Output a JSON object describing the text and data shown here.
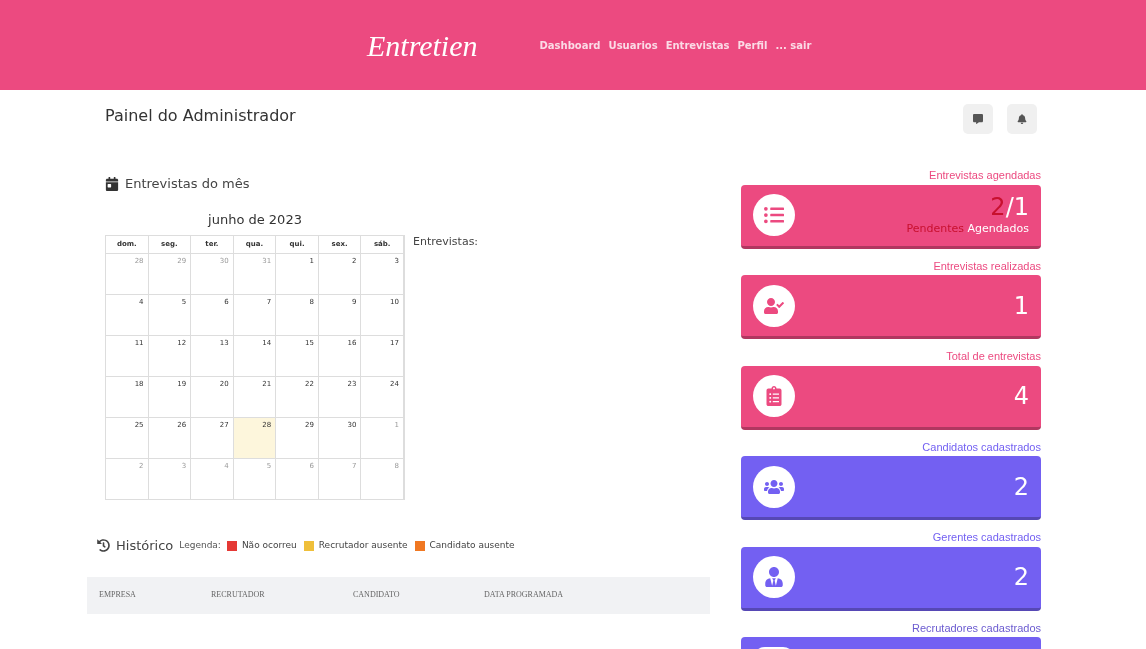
{
  "navbar": {
    "logo": "Entretien",
    "links": [
      {
        "label": "Dashboard"
      },
      {
        "label": "Usuarios"
      },
      {
        "label": "Entrevistas"
      },
      {
        "label": "Perfil"
      },
      {
        "label": "... sair"
      }
    ]
  },
  "page_title": "Painel do Administrador",
  "calendar": {
    "heading": "Entrevistas do mês",
    "month": "junho de 2023",
    "side_label": "Entrevistas:",
    "weekdays": [
      "dom.",
      "seg.",
      "ter.",
      "qua.",
      "qui.",
      "sex.",
      "sáb."
    ],
    "weeks": [
      [
        {
          "label": "28",
          "outside": true,
          "today": false
        },
        {
          "label": "29",
          "outside": true,
          "today": false
        },
        {
          "label": "30",
          "outside": true,
          "today": false
        },
        {
          "label": "31",
          "outside": true,
          "today": false
        },
        {
          "label": "1",
          "outside": false,
          "today": false
        },
        {
          "label": "2",
          "outside": false,
          "today": false
        },
        {
          "label": "3",
          "outside": false,
          "today": false
        }
      ],
      [
        {
          "label": "4",
          "outside": false,
          "today": false
        },
        {
          "label": "5",
          "outside": false,
          "today": false
        },
        {
          "label": "6",
          "outside": false,
          "today": false
        },
        {
          "label": "7",
          "outside": false,
          "today": false
        },
        {
          "label": "8",
          "outside": false,
          "today": false
        },
        {
          "label": "9",
          "outside": false,
          "today": false
        },
        {
          "label": "10",
          "outside": false,
          "today": false
        }
      ],
      [
        {
          "label": "11",
          "outside": false,
          "today": false
        },
        {
          "label": "12",
          "outside": false,
          "today": false
        },
        {
          "label": "13",
          "outside": false,
          "today": false
        },
        {
          "label": "14",
          "outside": false,
          "today": false
        },
        {
          "label": "15",
          "outside": false,
          "today": false
        },
        {
          "label": "16",
          "outside": false,
          "today": false
        },
        {
          "label": "17",
          "outside": false,
          "today": false
        }
      ],
      [
        {
          "label": "18",
          "outside": false,
          "today": false
        },
        {
          "label": "19",
          "outside": false,
          "today": false
        },
        {
          "label": "20",
          "outside": false,
          "today": false
        },
        {
          "label": "21",
          "outside": false,
          "today": false
        },
        {
          "label": "22",
          "outside": false,
          "today": false
        },
        {
          "label": "23",
          "outside": false,
          "today": false
        },
        {
          "label": "24",
          "outside": false,
          "today": false
        }
      ],
      [
        {
          "label": "25",
          "outside": false,
          "today": false
        },
        {
          "label": "26",
          "outside": false,
          "today": false
        },
        {
          "label": "27",
          "outside": false,
          "today": false
        },
        {
          "label": "28",
          "outside": false,
          "today": true
        },
        {
          "label": "29",
          "outside": false,
          "today": false
        },
        {
          "label": "30",
          "outside": false,
          "today": false
        },
        {
          "label": "1",
          "outside": true,
          "today": false
        }
      ],
      [
        {
          "label": "2",
          "outside": true,
          "today": false
        },
        {
          "label": "3",
          "outside": true,
          "today": false
        },
        {
          "label": "4",
          "outside": true,
          "today": false
        },
        {
          "label": "5",
          "outside": true,
          "today": false
        },
        {
          "label": "6",
          "outside": true,
          "today": false
        },
        {
          "label": "7",
          "outside": true,
          "today": false
        },
        {
          "label": "8",
          "outside": true,
          "today": false
        }
      ]
    ]
  },
  "history": {
    "heading": "Histórico",
    "legend_label": "Legenda:",
    "legend": [
      {
        "label": "Não ocorreu",
        "color": "#e53935"
      },
      {
        "label": "Recrutador ausente",
        "color": "#efbf3a"
      },
      {
        "label": "Candidato ausente",
        "color": "#f07822"
      }
    ],
    "columns": [
      "EMPRESA",
      "RECRUTADOR",
      "CANDIDATO",
      "DATA PROGRAMADA"
    ]
  },
  "stats": [
    {
      "kind": "split",
      "label": "Entrevistas agendadas",
      "color": "#ec4a80",
      "value": "2",
      "separator": "/",
      "value_secondary": "1",
      "sub_primary": "Pendentes",
      "sub_secondary": "Agendados"
    },
    {
      "kind": "single",
      "label": "Entrevistas realizadas",
      "color": "#ec4a80",
      "value": "1"
    },
    {
      "kind": "single",
      "label": "Total de entrevistas",
      "color": "#ec4a80",
      "value": "4"
    },
    {
      "kind": "single",
      "label": "Candidatos cadastrados",
      "color": "#7360f2",
      "value": "2"
    },
    {
      "kind": "single",
      "label": "Gerentes cadastrados",
      "color": "#7360f2",
      "value": "2"
    },
    {
      "kind": "cut",
      "label": "Recrutadores cadastrados",
      "color": "#7360f2"
    }
  ]
}
